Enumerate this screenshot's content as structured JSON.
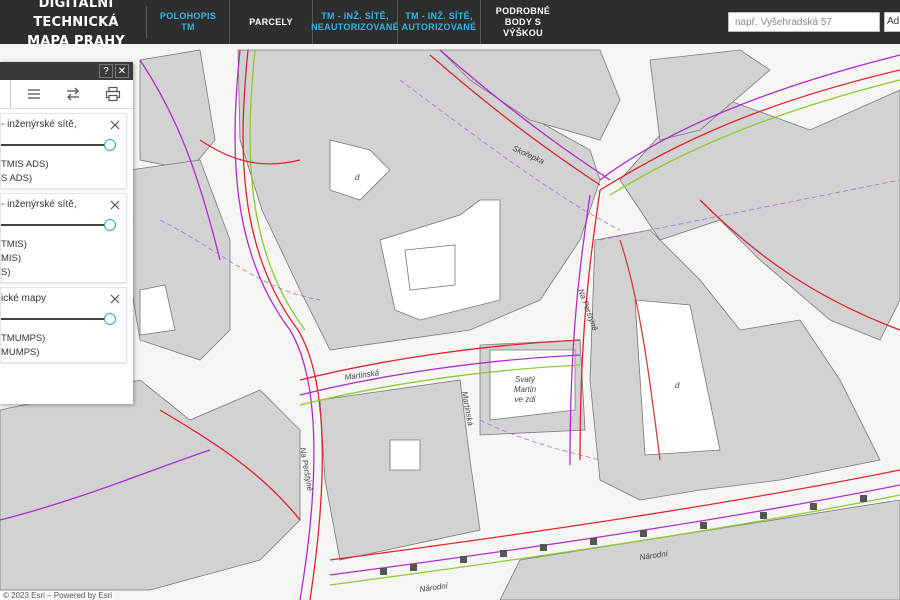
{
  "header": {
    "brand_line1": "DIGITÁLNÍ TECHNICKÁ",
    "brand_line2": "MAPA PRAHY",
    "nav": [
      {
        "line1": "POLOHOPIS TM",
        "line2": "",
        "color": "#35b3e6"
      },
      {
        "line1": "PARCELY",
        "line2": "",
        "color": "#ffffff"
      },
      {
        "line1": "TM - INŽ. SÍTĚ,",
        "line2": "NEAUTORIZOVANÉ",
        "color": "#35b3e6"
      },
      {
        "line1": "TM - INŽ. SÍTĚ,",
        "line2": "AUTORIZOVANÉ",
        "color": "#35b3e6"
      },
      {
        "line1": "PODROBNÉ BODY S",
        "line2": "VÝŠKOU",
        "color": "#ffffff"
      }
    ],
    "search_placeholder": "např. Vyšehradská 57",
    "search_button_label": "Ad"
  },
  "panel": {
    "help_label": "?",
    "close_label": "✕",
    "toolbar_icons": [
      "layers-list-icon",
      "swap-icon",
      "print-icon"
    ],
    "layers": [
      {
        "title": "- inženýrské sítě,",
        "legend": [
          "TMIS ADS)",
          "S ADS)"
        ]
      },
      {
        "title": "- inženýrské sítě,",
        "legend": [
          "TMIS)",
          "MIS)",
          "S)"
        ]
      },
      {
        "title": "ické mapy",
        "legend": [
          "TMUMPS)",
          "MUMPS)"
        ]
      }
    ]
  },
  "map": {
    "street_labels": [
      "Skořepka",
      "Martinská",
      "Martinská",
      "Na Perštýně",
      "Národní",
      "Národní",
      "Na Perštýně"
    ],
    "church_label_lines": [
      "Svatý",
      "Martin",
      "ve zdi"
    ],
    "parcel_letter": "d"
  },
  "attribution": "© 2023 Esri – Powered by Esri"
}
